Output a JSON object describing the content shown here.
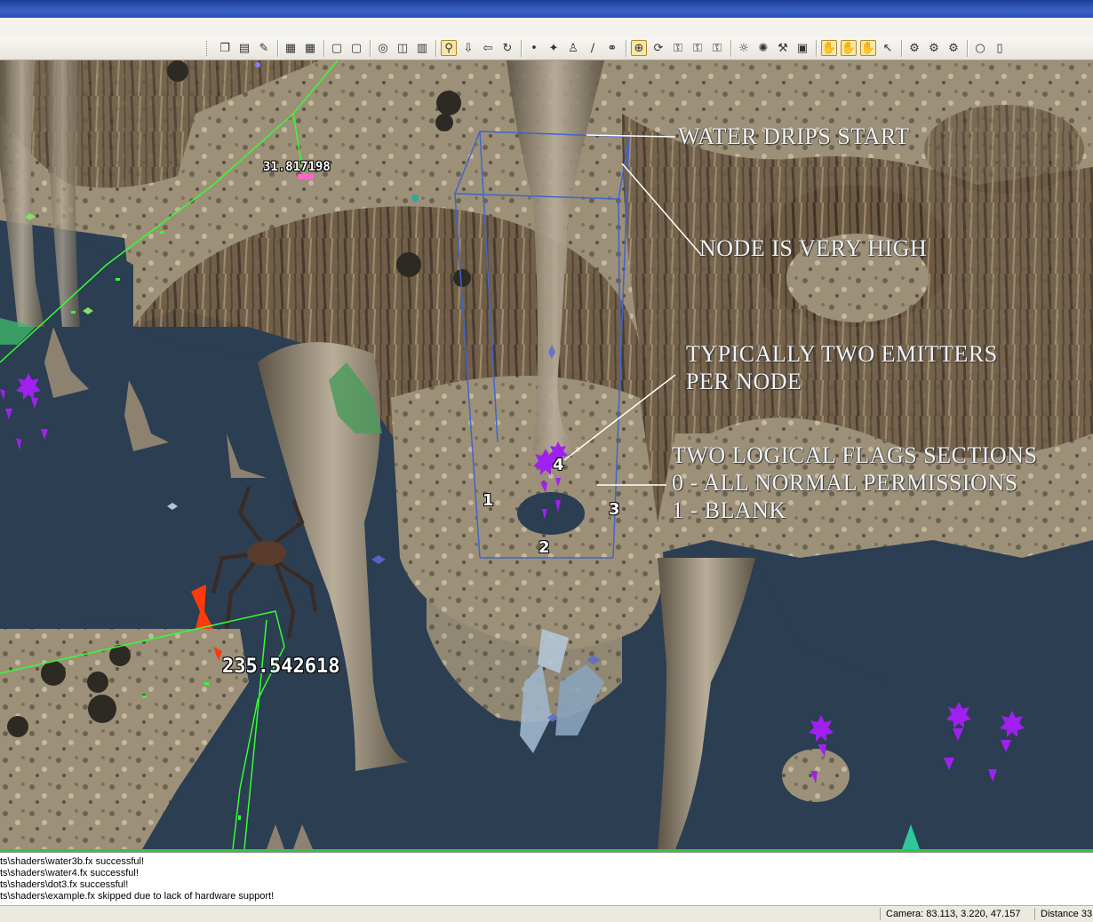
{
  "toolbar": {
    "icons": [
      "copy-icon",
      "paste-icon",
      "wand-icon",
      "grid-icon",
      "grid-icon",
      "page-icon",
      "page-icon",
      "target-icon",
      "pan-icon",
      "chart-icon",
      "pick-icon",
      "move-down-icon",
      "move-left-icon",
      "rotate-icon",
      "node-icon",
      "spawn-icon",
      "person-icon",
      "line-icon",
      "link-icon",
      "select-icon",
      "rotate-view-icon",
      "lock-icon",
      "lock-icon",
      "lock-icon",
      "sun-icon",
      "bright-icon",
      "tool-icon",
      "box-icon",
      "hand-icon",
      "hand-icon",
      "hand-icon",
      "cursor-icon",
      "gear-icon",
      "gear-icon",
      "gear-icon",
      "circle-icon",
      "exit-icon"
    ]
  },
  "viewport": {
    "annotations": {
      "water_drips": "WATER DRIPS START",
      "node_high": "NODE IS VERY HIGH",
      "two_emitters": "TYPICALLY TWO EMITTERS\nPER NODE",
      "flags": "TWO LOGICAL FLAGS SECTIONS\n0 - ALL NORMAL PERMISSIONS\n1 - BLANK"
    },
    "distances": {
      "near": "31.817198",
      "far": "235.542618"
    },
    "node_numbers": [
      "1",
      "2",
      "3",
      "4"
    ],
    "colors": {
      "water": "#2b3e52",
      "rock": "#8a7a60",
      "path_green": "#33ff33",
      "node_box": "#3f66c8",
      "emitter_purple": "#a020f0",
      "red_marker": "#ff3300"
    }
  },
  "console": {
    "lines": [
      "ts\\shaders\\water3b.fx successful!",
      "ts\\shaders\\water4.fx successful!",
      "ts\\shaders\\dot3.fx successful!",
      "ts\\shaders\\example.fx skipped due to lack of hardware support!"
    ]
  },
  "statusbar": {
    "camera": "Camera: 83.113, 3.220, 47.157",
    "distance": "Distance 33"
  }
}
